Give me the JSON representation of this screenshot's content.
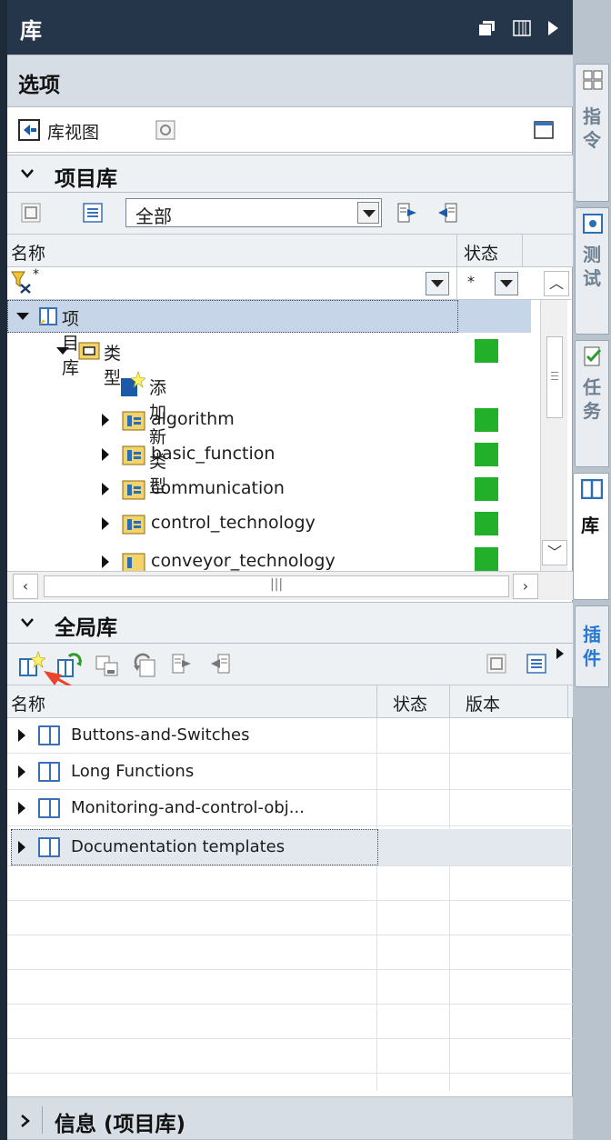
{
  "titlebar": {
    "title": "库"
  },
  "options": {
    "title": "选项",
    "library_view_label": "库视图"
  },
  "project_library": {
    "section_title": "项目库",
    "filter_value": "全部",
    "columns": {
      "name": "名称",
      "status": "状态"
    },
    "filter_row": {
      "status_filter": "*"
    },
    "tree": [
      {
        "label": "项目库",
        "level": 0,
        "expanded": true,
        "selected": true,
        "status": ""
      },
      {
        "label": "类型",
        "level": 1,
        "expanded": true,
        "status": "green"
      },
      {
        "label": "添加新类型",
        "level": 2,
        "status": ""
      },
      {
        "label": "algorithm",
        "level": 2,
        "status": "green"
      },
      {
        "label": "basic_function",
        "level": 2,
        "status": "green"
      },
      {
        "label": "communication",
        "level": 2,
        "status": "green"
      },
      {
        "label": "control_technology",
        "level": 2,
        "status": "green"
      },
      {
        "label": "conveyor_technology",
        "level": 2,
        "status": "green"
      }
    ]
  },
  "global_library": {
    "section_title": "全局库",
    "columns": {
      "name": "名称",
      "status": "状态",
      "version": "版本"
    },
    "items": [
      {
        "label": "Buttons-and-Switches"
      },
      {
        "label": "Long Functions"
      },
      {
        "label": "Monitoring-and-control-obj..."
      },
      {
        "label": "Documentation templates"
      }
    ]
  },
  "info_section": {
    "title": "信息 (项目库)"
  },
  "side_tabs": [
    {
      "label": "指令",
      "state": "inactive"
    },
    {
      "label": "测试",
      "state": "inactive"
    },
    {
      "label": "任务",
      "state": "inactive"
    },
    {
      "label": "库",
      "state": "active"
    },
    {
      "label": "插件",
      "state": "plugin"
    }
  ],
  "colors": {
    "titlebar": "#26364a",
    "status_green": "#22b02a",
    "selection": "#c7d5e8",
    "accent": "#2778d4",
    "arrow": "#e8452c"
  }
}
